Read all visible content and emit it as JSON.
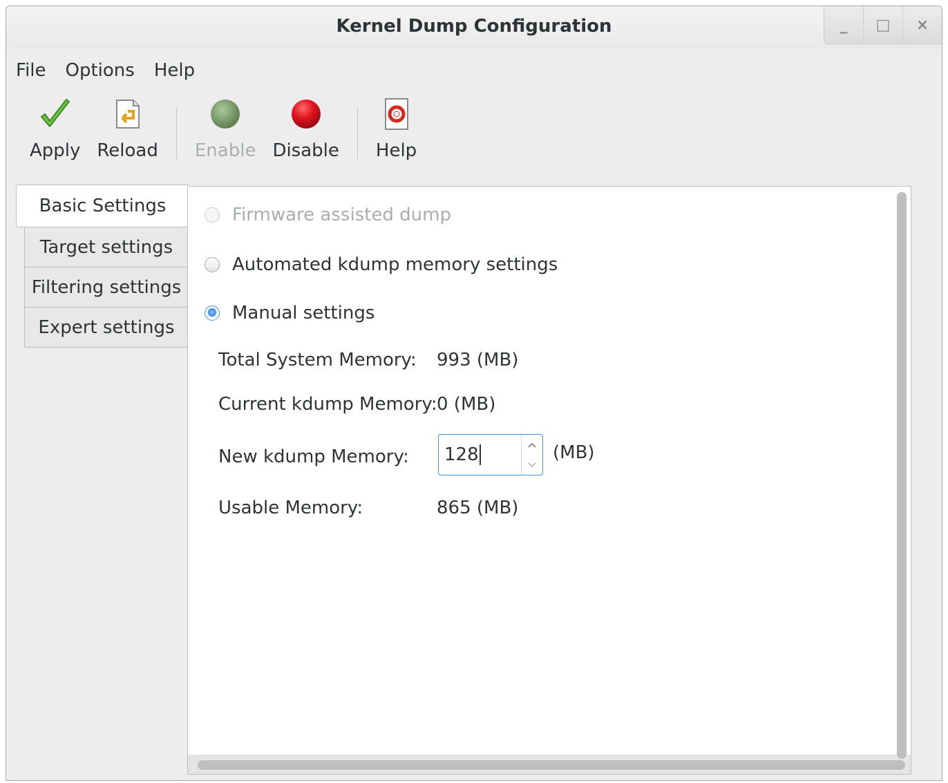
{
  "window": {
    "title": "Kernel Dump Configuration",
    "controls": [
      "_",
      "□",
      "×"
    ]
  },
  "menu": [
    "File",
    "Options",
    "Help"
  ],
  "toolbar": {
    "apply": {
      "label": "Apply",
      "icon": "checkmark-icon",
      "enabled": true
    },
    "reload": {
      "label": "Reload",
      "icon": "reload-document-icon",
      "enabled": true
    },
    "enable": {
      "label": "Enable",
      "icon": "green-circle-icon",
      "enabled": false
    },
    "disable": {
      "label": "Disable",
      "icon": "red-circle-icon",
      "enabled": true
    },
    "help": {
      "label": "Help",
      "icon": "help-lifebuoy-icon",
      "enabled": true
    }
  },
  "tabs": [
    {
      "label": "Basic Settings",
      "active": true
    },
    {
      "label": "Target settings",
      "active": false
    },
    {
      "label": "Filtering settings",
      "active": false
    },
    {
      "label": "Expert settings",
      "active": false
    }
  ],
  "basic": {
    "options": [
      {
        "label": "Firmware assisted dump",
        "checked": false,
        "enabled": false
      },
      {
        "label": "Automated kdump memory settings",
        "checked": false,
        "enabled": true
      },
      {
        "label": "Manual settings",
        "checked": true,
        "enabled": true
      }
    ],
    "total_memory": {
      "label": "Total System Memory:",
      "value": "993 (MB)"
    },
    "current_memory": {
      "label": "Current kdump Memory:",
      "value": "0 (MB)"
    },
    "new_memory": {
      "label": "New kdump Memory:",
      "value": "128",
      "unit": "(MB)"
    },
    "usable_memory": {
      "label": "Usable Memory:",
      "value": "865 (MB)"
    }
  },
  "colors": {
    "accent": "#4a90d9",
    "apply_green": "#6cc644",
    "disable_red": "#e0141e",
    "enable_green_disabled": "#7fa16a"
  }
}
